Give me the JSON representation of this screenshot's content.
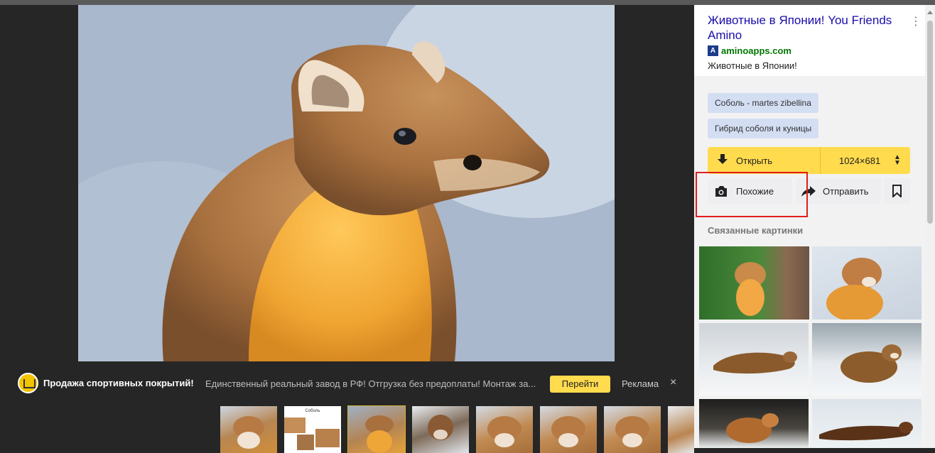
{
  "snippet": {
    "title": "Животные в Японии! You Friends Amino",
    "site": "aminoapps.com",
    "description": "Животные в Японии!"
  },
  "tags": [
    "Соболь - martes zibellina",
    "Гибрид соболя и куницы"
  ],
  "actions": {
    "open_label": "Открыть",
    "size_label": "1024×681",
    "similar_label": "Похожие",
    "share_label": "Отправить"
  },
  "related": {
    "heading": "Связанные картинки"
  },
  "ad": {
    "title": "Продажа спортивных покрытий!",
    "text": "Единственный реальный завод в РФ! Отгрузка без предоплаты! Монтаж за...",
    "button": "Перейти",
    "label": "Реклама",
    "close": "×"
  },
  "strip": {
    "thumb2_caption": "Соболь"
  },
  "colors": {
    "accent": "#ffdb4d",
    "link": "#1a0dab",
    "site": "#007700",
    "highlight": "#e01e1e"
  },
  "icons": [
    "download-icon",
    "camera-search-icon",
    "share-arrow-icon",
    "bookmark-icon",
    "more-vertical-icon"
  ]
}
